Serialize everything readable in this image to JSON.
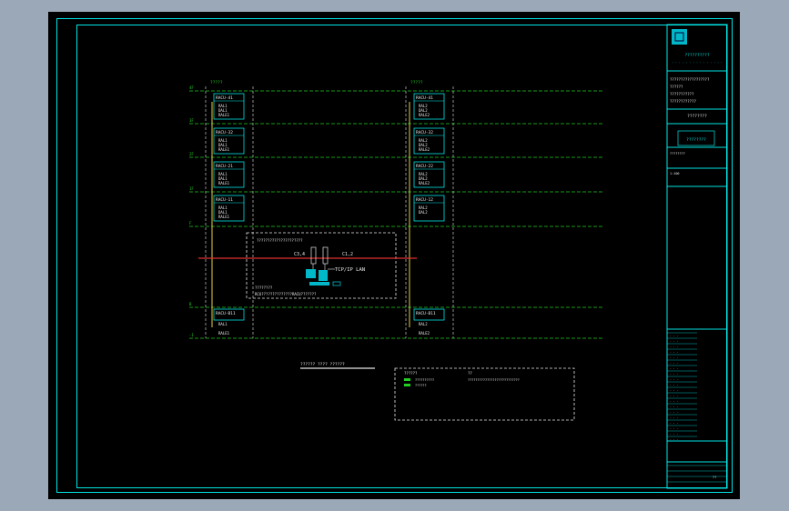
{
  "drawing": {
    "columns": [
      {
        "label": "?????",
        "boxes": [
          "RACU-41",
          "RACU-32",
          "RACU-21",
          "RACU-11"
        ],
        "basement": "RACU-B11"
      },
      {
        "label": "?????",
        "boxes": [
          "RACU-41",
          "RACU-32",
          "RACU-22",
          "RACU-12"
        ],
        "basement": "RACU-B11"
      }
    ],
    "floors": [
      "4F",
      "3F",
      "2F",
      "1F",
      "F",
      "B",
      "-1"
    ],
    "box_lines_left": [
      [
        "RAL1",
        "DAL1",
        "RALE1"
      ],
      [
        "RAL1",
        "DAL1",
        "RALE1"
      ],
      [
        "RAL1",
        "DAL1",
        "RALE1"
      ],
      [
        "RAL1",
        "DAL1",
        "RALE1"
      ]
    ],
    "box_lines_right": [
      [
        "RAL2",
        "DAL2",
        "RALE2"
      ],
      [
        "RAL2",
        "DAL2",
        "RALE2"
      ],
      [
        "RAL2",
        "DAL2",
        "RALE2"
      ],
      [
        "RAL2",
        "DAL2"
      ]
    ],
    "basement_left": [
      "RAL1",
      "RALE1"
    ],
    "basement_right": [
      "RAL2",
      "RALE2"
    ],
    "control_room": {
      "title": "?????????????????????",
      "bus_left": "C3,4",
      "bus_right": "C1,2",
      "network": "TCP/IP LAN",
      "footer1": "????????",
      "footer2": "RCU??????????????RACU???????"
    },
    "diagram_title": "?????? ???? ??????",
    "legend": {
      "title": "??????",
      "items": [
        "??????????",
        "??????"
      ],
      "notes": "???????????????????????????"
    }
  },
  "title_block": {
    "company": "??????????",
    "project_lines": [
      "??????????????????",
      "??????",
      "???????????",
      "????????????"
    ],
    "drawing_name": "????????",
    "drawing_no": "????????",
    "scale": "1:100",
    "page": "??"
  },
  "colors": {
    "background": "#000000",
    "frame": "#00e5e5",
    "floor_line": "#22cc22",
    "bus": "#e03030",
    "riser": "#e0d040",
    "text": "#e8e8e8"
  }
}
